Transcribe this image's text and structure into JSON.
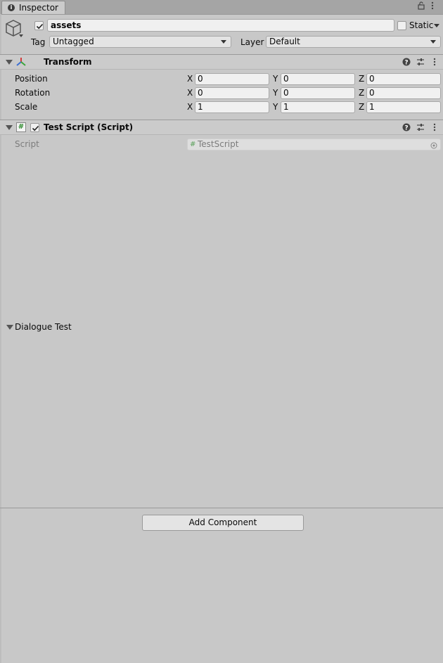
{
  "window": {
    "tab_label": "Inspector",
    "tab_icon": "info-icon",
    "lock_icon": "lock-icon",
    "menu_icon": "kebab-menu-icon"
  },
  "header": {
    "object_name": "assets",
    "active_checked": true,
    "static_label": "Static",
    "static_checked": false,
    "tag_label": "Tag",
    "tag_value": "Untagged",
    "layer_label": "Layer",
    "layer_value": "Default",
    "object_icon": "cube-icon"
  },
  "transform": {
    "title": "Transform",
    "rows": [
      {
        "label": "Position",
        "x": "0",
        "y": "0",
        "z": "0"
      },
      {
        "label": "Rotation",
        "x": "0",
        "y": "0",
        "z": "0"
      },
      {
        "label": "Scale",
        "x": "1",
        "y": "1",
        "z": "1"
      }
    ],
    "axis_x": "X",
    "axis_y": "Y",
    "axis_z": "Z"
  },
  "script_component": {
    "title": "Test Script (Script)",
    "enabled": true,
    "script_label": "Script",
    "script_value": "TestScript",
    "section_label": "Dialogue Test"
  },
  "footer": {
    "add_component_label": "Add Component"
  },
  "colors": {
    "panel_bg": "#c8c8c8",
    "tab_bar_bg": "#a5a5a5",
    "field_bg": "#f0f0f0",
    "transform_red": "#d23b3b",
    "transform_green": "#3ba53b",
    "transform_blue": "#3b6fd2"
  }
}
